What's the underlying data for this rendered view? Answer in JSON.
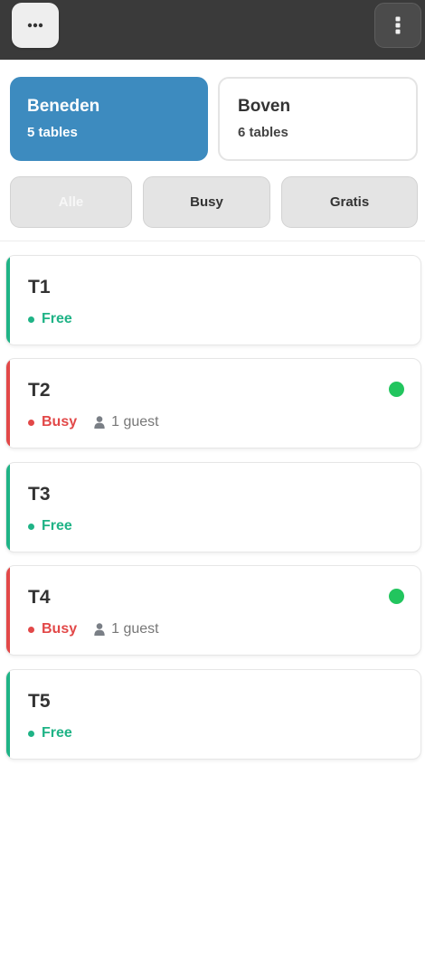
{
  "topbar": {
    "left_icon": "ellipsis-icon",
    "right_icon": "vertical-dots-icon"
  },
  "floors": [
    {
      "name": "Beneden",
      "count": "5 tables",
      "active": true
    },
    {
      "name": "Boven",
      "count": "6 tables",
      "active": false
    }
  ],
  "filters": [
    {
      "label": "Alle"
    },
    {
      "label": "Busy"
    },
    {
      "label": "Gratis"
    }
  ],
  "tables": [
    {
      "name": "T1",
      "status": "Free",
      "guests": ""
    },
    {
      "name": "T2",
      "status": "Busy",
      "guests": "1 guest"
    },
    {
      "name": "T3",
      "status": "Free",
      "guests": ""
    },
    {
      "name": "T4",
      "status": "Busy",
      "guests": "1 guest"
    },
    {
      "name": "T5",
      "status": "Free",
      "guests": ""
    }
  ],
  "colors": {
    "topbar": "#3a3a3a",
    "active_floor": "#3d8bbf",
    "free": "#1fb386",
    "busy": "#e24848",
    "indicator": "#22c55e"
  }
}
